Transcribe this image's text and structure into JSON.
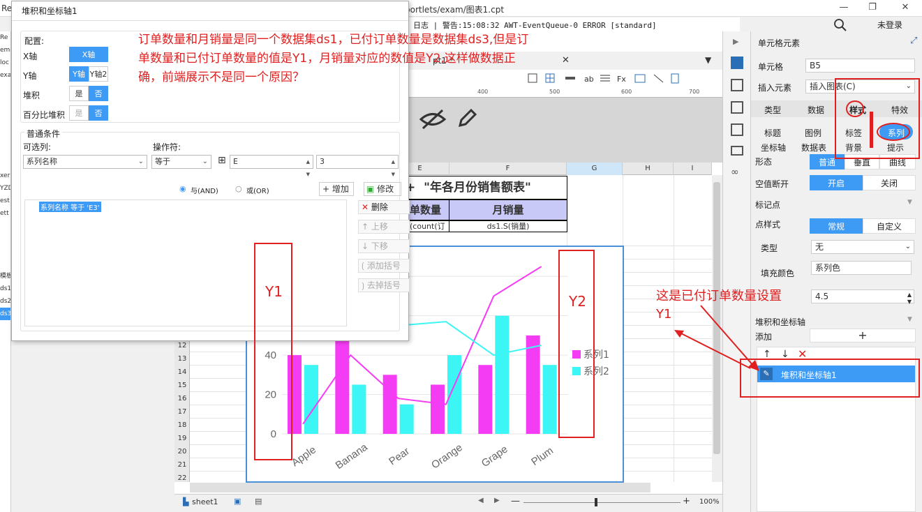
{
  "window": {
    "title_left": "Re",
    "path": "portlets/exam/图表1.cpt",
    "controls": [
      "—",
      "❐",
      "✕"
    ]
  },
  "status_line": "日志 | 警告:15:08:32 AWT-EventQueue-0 ERROR [standard]",
  "top_right": {
    "login": "未登录"
  },
  "left_strip": [
    "Re",
    "emo",
    "loc",
    "exa",
    "",
    "",
    "",
    "",
    "",
    "",
    "",
    "xer",
    "YZD",
    "est",
    "ett",
    "",
    "",
    "",
    "",
    "模板",
    "ds1",
    "ds2",
    "ds3"
  ],
  "editor_tab": {
    "label": "pt1 *",
    "close": "✕"
  },
  "ruler": {
    "ticks": [
      "400",
      "500",
      "600",
      "700"
    ]
  },
  "columns": [
    "E",
    "F",
    "G",
    "H",
    "I"
  ],
  "rows": [
    "12",
    "13",
    "14",
    "15",
    "16",
    "17",
    "18",
    "19",
    "20",
    "21",
    "22"
  ],
  "report": {
    "title": "\"年各月份销售额表\"",
    "title_prefix": "+",
    "header_e": "订单数量",
    "header_f": "月销量",
    "cell_e": "(count(订",
    "cell_f": "ds1.S(销量)"
  },
  "dialog": {
    "title": "堆积和坐标轴1",
    "config_label": "配置:",
    "x_axis_label": "X轴",
    "x_axis_btn": "X轴",
    "y_axis_label": "Y轴",
    "y_axis_btn1": "Y轴",
    "y_axis_btn2": "Y轴2",
    "stack_label": "堆积",
    "stack_yes": "是",
    "stack_no": "否",
    "pct_label": "百分比堆积",
    "pct_yes": "是",
    "pct_no": "否",
    "cond_title": "普通条件",
    "col_label": "可选列:",
    "op_label": "操作符:",
    "col_value": "系列名称",
    "op_value": "等于",
    "val_e": "E",
    "val_num": "3",
    "and_label": "与(AND)",
    "or_label": "或(OR)",
    "add_btn": "增加",
    "edit_btn": "修改",
    "condition_item": "系列名称 等于 'E3'",
    "delete_btn": "删除",
    "up_btn": "上移",
    "down_btn": "下移",
    "add_bracket_btn": "添加括号",
    "remove_bracket_btn": "去掉括号"
  },
  "annotations": {
    "main_question": "订单数量和月销量是同一个数据集ds1，已付订单数量是数据集ds3,但是订单数量和已付订单数量的值是Y1，月销量对应的数值是Y2,这样做数据正确，前端展示不是同一个原因？",
    "y1": "Y1",
    "y2": "Y2",
    "paid_note": "这是已付订单数量设置Y1"
  },
  "right_panel": {
    "title": "单元格元素",
    "cell_label": "单元格",
    "cell_value": "B5",
    "insert_label": "插入元素",
    "insert_value": "插入图表(C)",
    "tabs": [
      "类型",
      "数据",
      "样式",
      "特效"
    ],
    "subtabs_row1": [
      "标题",
      "图例",
      "标签",
      "系列"
    ],
    "subtabs_row2": [
      "坐标轴",
      "数据表",
      "背景",
      "提示"
    ],
    "shape_label": "形态",
    "shape_options": [
      "普通",
      "垂直",
      "曲线"
    ],
    "null_label": "空值断开",
    "null_on": "开启",
    "null_off": "关闭",
    "marker_section": "标记点",
    "point_style_label": "点样式",
    "point_style_normal": "常规",
    "point_style_custom": "自定义",
    "type_label": "类型",
    "type_value": "无",
    "fill_label": "填充颜色",
    "fill_value": "系列色",
    "size_value": "4.5",
    "stack_section": "堆积和坐标轴",
    "add_label": "添加",
    "add_plus": "+",
    "stack_item": "堆积和坐标轴1"
  },
  "bottom": {
    "sheet_tab": "sheet1",
    "zoom": "100%"
  },
  "chart_data": {
    "type": "bar",
    "categories": [
      "Apple",
      "Banana",
      "Pear",
      "Orange",
      "Grape",
      "Plum"
    ],
    "series": [
      {
        "name": "系列1",
        "type": "bar",
        "values": [
          40,
          50,
          30,
          25,
          35,
          50
        ],
        "color": "#f53cf5"
      },
      {
        "name": "系列2",
        "type": "bar",
        "values": [
          35,
          25,
          15,
          40,
          60,
          35
        ],
        "color": "#3cf5f5"
      }
    ],
    "lines": [
      {
        "color": "#f53cf5",
        "values": [
          5,
          40,
          18,
          15,
          70,
          85
        ]
      },
      {
        "color": "#3cf5f5",
        "values": [
          55,
          52,
          55,
          57,
          40,
          45
        ]
      }
    ],
    "y_ticks": [
      0,
      20,
      40
    ],
    "ylim": [
      0,
      90
    ],
    "legend": "right"
  },
  "colors": {
    "accent": "#3d9af5",
    "annotation": "#e02020"
  }
}
